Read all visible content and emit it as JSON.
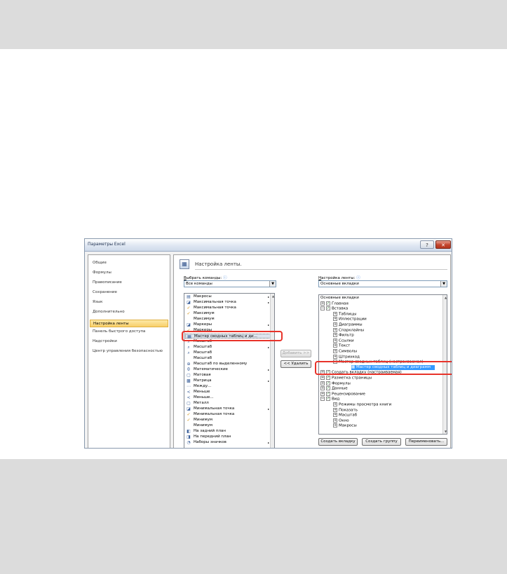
{
  "window": {
    "title": "Параметры Excel"
  },
  "colors": {
    "highlight": "#e8332a",
    "selection": "#3399ff",
    "nav_selected": "#f8cf6a"
  },
  "nav": {
    "items": [
      {
        "label": "Общие"
      },
      {
        "label": "Формулы"
      },
      {
        "label": "Правописание"
      },
      {
        "label": "Сохранение"
      },
      {
        "label": "Язык"
      },
      {
        "label": "Дополнительно"
      },
      {
        "label": "Настройка ленты",
        "selected": true
      },
      {
        "label": "Панель быстрого доступа"
      },
      {
        "label": "Надстройки"
      },
      {
        "label": "Центр управления безопасностью"
      }
    ]
  },
  "main": {
    "header": "Настройка ленты.",
    "commands": {
      "label_prefix": "В",
      "label_rest": "ыбрать команды:",
      "selected": "Все команды",
      "items": [
        {
          "label": "Макросы",
          "icon": "macro-icon",
          "submenu": true
        },
        {
          "label": "Максимальная точка",
          "icon": "chart-icon",
          "submenu": true
        },
        {
          "label": "Максимальная точка",
          "icon": "check-icon"
        },
        {
          "label": "Максимум",
          "icon": "check-icon"
        },
        {
          "label": "Максимум",
          "icon": ""
        },
        {
          "label": "Маркеры",
          "icon": "chart-icon",
          "submenu": true
        },
        {
          "label": "Маркеры",
          "icon": "check-icon"
        },
        {
          "label": "Мастер сводных таблиц и ди...",
          "icon": "pivot-icon",
          "selected": true
        },
        {
          "label": "Масштаб",
          "icon": "zoom-icon"
        },
        {
          "label": "Масштаб",
          "icon": "zoom-icon",
          "submenu": true
        },
        {
          "label": "Масштаб",
          "icon": "zoom-icon"
        },
        {
          "label": "Масштаб",
          "icon": ""
        },
        {
          "label": "Масштаб по выделенному",
          "icon": "zoom-selection-icon"
        },
        {
          "label": "Математические",
          "icon": "math-icon",
          "submenu": true
        },
        {
          "label": "Матовая",
          "icon": "style-icon"
        },
        {
          "label": "Матрица",
          "icon": "matrix-icon",
          "submenu": true
        },
        {
          "label": "Между...",
          "icon": "between-icon"
        },
        {
          "label": "Меньше",
          "icon": "less-icon"
        },
        {
          "label": "Меньше...",
          "icon": "less-icon"
        },
        {
          "label": "Металл",
          "icon": "style-icon"
        },
        {
          "label": "Минимальная точка",
          "icon": "chart-icon",
          "submenu": true
        },
        {
          "label": "Минимальная точка",
          "icon": "check-icon"
        },
        {
          "label": "Минимум",
          "icon": "check-icon"
        },
        {
          "label": "Минимум",
          "icon": ""
        },
        {
          "label": "На задний план",
          "icon": "send-back-icon"
        },
        {
          "label": "На передний план",
          "icon": "bring-front-icon"
        },
        {
          "label": "Наборы значков",
          "icon": "icon-sets-icon",
          "submenu": true
        }
      ]
    },
    "add_button": "Добавить >>",
    "remove_button": "<< Удалить",
    "ribbon": {
      "label_prefix": "Н",
      "label_rest": "астройка ленты:",
      "selected": "Основные вкладки",
      "tree": [
        {
          "label": "Основные вкладки",
          "level": 0
        },
        {
          "label": "Главная",
          "level": 0,
          "expander": "+",
          "check": true
        },
        {
          "label": "Вставка",
          "level": 0,
          "expander": "−",
          "check": true
        },
        {
          "label": "Таблицы",
          "level": 1,
          "expander": "+"
        },
        {
          "label": "Иллюстрации",
          "level": 1,
          "expander": "+"
        },
        {
          "label": "Диаграммы",
          "level": 1,
          "expander": "+"
        },
        {
          "label": "Спарклайны",
          "level": 1,
          "expander": "+"
        },
        {
          "label": "Фильтр",
          "level": 1,
          "expander": "+"
        },
        {
          "label": "Ссылки",
          "level": 1,
          "expander": "+"
        },
        {
          "label": "Текст",
          "level": 1,
          "expander": "+"
        },
        {
          "label": "Символы",
          "level": 1,
          "expander": "+"
        },
        {
          "label": "Штрихкод",
          "level": 1,
          "expander": "+"
        },
        {
          "label": "Мастер сводных таблиц (настраиваемая)",
          "level": 1,
          "expander": "−"
        },
        {
          "label": "Мастер сводных таблиц и диаграмм",
          "level": 2,
          "selected": true
        },
        {
          "label": "Создать вкладку (настраиваемая)",
          "level": 0,
          "expander": "+",
          "check": true
        },
        {
          "label": "Разметка страницы",
          "level": 0,
          "expander": "+",
          "check": true
        },
        {
          "label": "Формулы",
          "level": 0,
          "expander": "+",
          "check": true
        },
        {
          "label": "Данные",
          "level": 0,
          "expander": "+",
          "check": true
        },
        {
          "label": "Рецензирование",
          "level": 0,
          "expander": "+",
          "check": true
        },
        {
          "label": "Вид",
          "level": 0,
          "expander": "−",
          "check": true
        },
        {
          "label": "Режимы просмотра книги",
          "level": 1,
          "expander": "+"
        },
        {
          "label": "Показать",
          "level": 1,
          "expander": "+"
        },
        {
          "label": "Масштаб",
          "level": 1,
          "expander": "+"
        },
        {
          "label": "Окно",
          "level": 1,
          "expander": "+"
        },
        {
          "label": "Макросы",
          "level": 1,
          "expander": "+"
        }
      ]
    },
    "bottom_buttons": {
      "new_tab": "Создать вкладку",
      "new_group": "Создать группу",
      "rename": "Переименовать..."
    }
  }
}
